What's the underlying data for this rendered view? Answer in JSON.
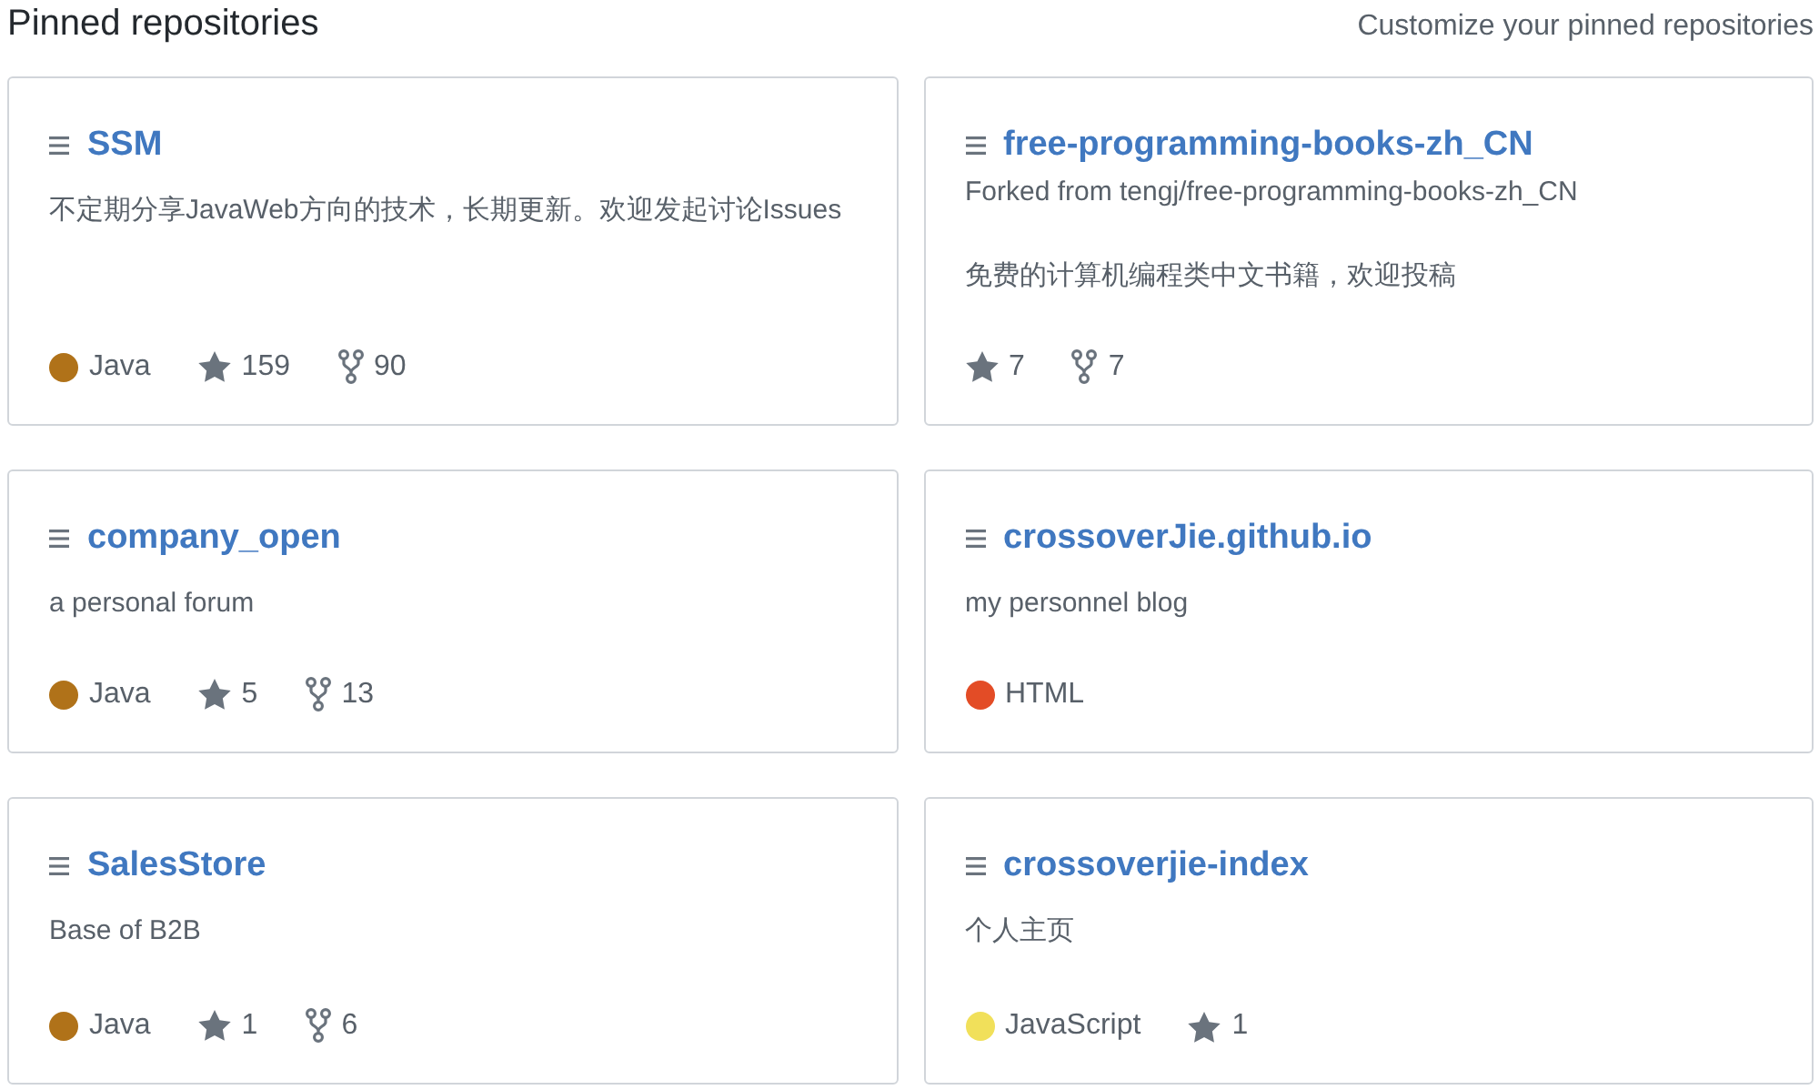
{
  "header": {
    "title": "Pinned repositories",
    "customize_link": "Customize your pinned repositories"
  },
  "repositories": [
    {
      "name": "SSM",
      "description": "不定期分享JavaWeb方向的技术，长期更新。欢迎发起讨论Issues",
      "language": {
        "name": "Java",
        "color": "#b07219"
      },
      "stars": "159",
      "forks": "90"
    },
    {
      "name": "free-programming-books-zh_CN",
      "forked_from": "Forked from tengj/free-programming-books-zh_CN",
      "description": "免费的计算机编程类中文书籍，欢迎投稿",
      "stars": "7",
      "forks": "7"
    },
    {
      "name": "company_open",
      "description": "a personal forum",
      "language": {
        "name": "Java",
        "color": "#b07219"
      },
      "stars": "5",
      "forks": "13"
    },
    {
      "name": "crossoverJie.github.io",
      "description": "my personnel blog",
      "language": {
        "name": "HTML",
        "color": "#e34c26"
      }
    },
    {
      "name": "SalesStore",
      "description": "Base of B2B",
      "language": {
        "name": "Java",
        "color": "#b07219"
      },
      "stars": "1",
      "forks": "6"
    },
    {
      "name": "crossoverjie-index",
      "description": "个人主页",
      "language": {
        "name": "JavaScript",
        "color": "#f1e05a"
      },
      "stars": "1"
    }
  ]
}
